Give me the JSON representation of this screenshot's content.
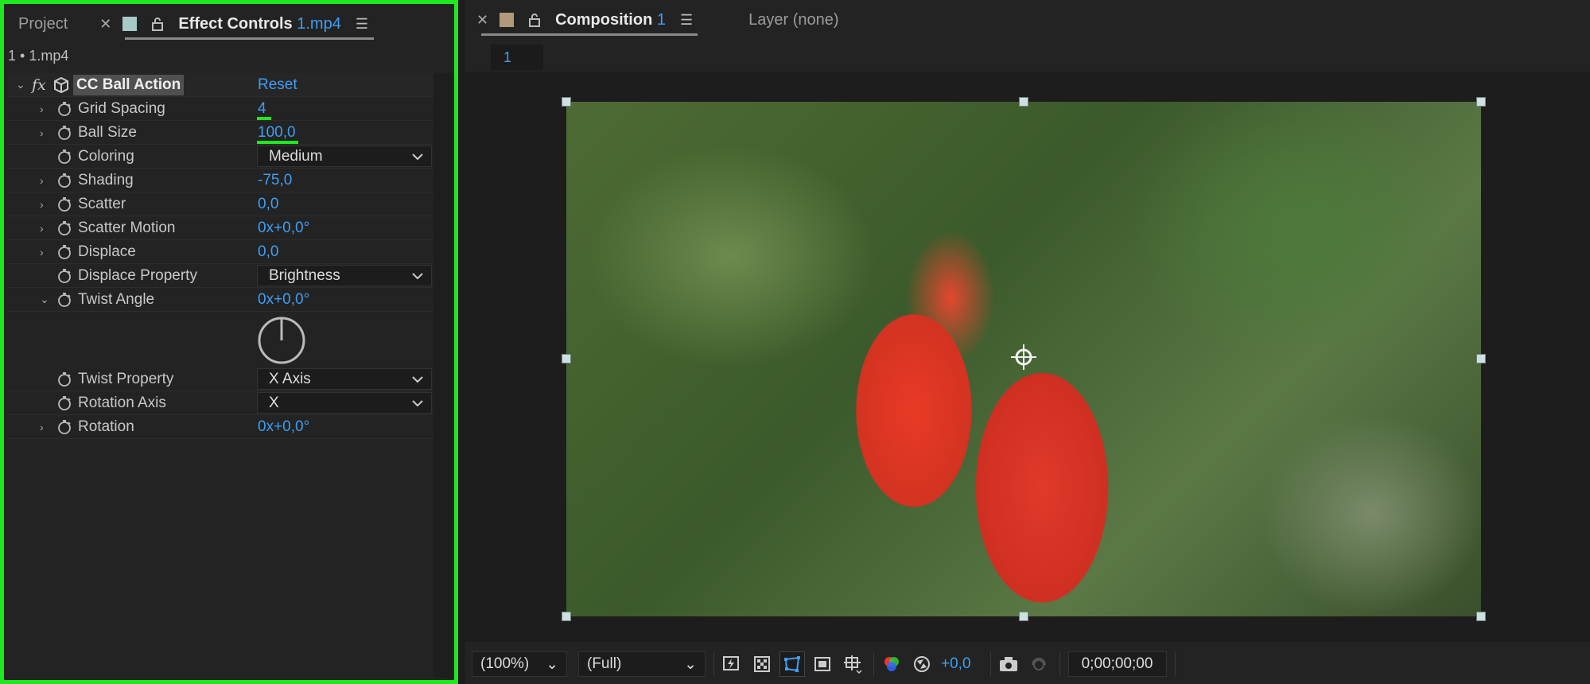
{
  "left_panel": {
    "tabs": [
      {
        "label": "Project"
      },
      {
        "label": "Effect Controls",
        "suffix": "1.mp4"
      }
    ],
    "layer_path": "1 • 1.mp4",
    "effect": {
      "name": "CC Ball Action",
      "fx_label": "fx",
      "reset_label": "Reset"
    },
    "properties": [
      {
        "name": "Grid Spacing",
        "value": "4",
        "kind": "value",
        "expand": "›"
      },
      {
        "name": "Ball Size",
        "value": "100,0",
        "kind": "value",
        "expand": "›"
      },
      {
        "name": "Coloring",
        "value": "Medium",
        "kind": "dropdown",
        "expand": ""
      },
      {
        "name": "Shading",
        "value": "-75,0",
        "kind": "value",
        "expand": "›"
      },
      {
        "name": "Scatter",
        "value": "0,0",
        "kind": "value",
        "expand": "›"
      },
      {
        "name": "Scatter Motion",
        "value": "0x+0,0°",
        "kind": "value",
        "expand": "›"
      },
      {
        "name": "Displace",
        "value": "0,0",
        "kind": "value",
        "expand": "›"
      },
      {
        "name": "Displace Property",
        "value": "Brightness",
        "kind": "dropdown",
        "expand": ""
      },
      {
        "name": "Twist Angle",
        "value": "0x+0,0°",
        "kind": "value",
        "expand": "⌄"
      },
      {
        "name": "Twist Property",
        "value": "X Axis",
        "kind": "dropdown",
        "expand": ""
      },
      {
        "name": "Rotation Axis",
        "value": "X",
        "kind": "dropdown",
        "expand": ""
      },
      {
        "name": "Rotation",
        "value": "0x+0,0°",
        "kind": "value",
        "expand": "›"
      }
    ]
  },
  "right_panel": {
    "tabs": [
      {
        "label": "Composition",
        "suffix": "1"
      },
      {
        "label": "Layer (none)"
      }
    ],
    "comp_breadcrumb": "1",
    "bottom": {
      "zoom": "(100%)",
      "resolution": "(Full)",
      "exposure": "+0,0",
      "timecode": "0;00;00;00"
    }
  },
  "colors": {
    "accent": "#3e9ef3",
    "highlight": "#1ee81e",
    "panel": "#232323"
  }
}
